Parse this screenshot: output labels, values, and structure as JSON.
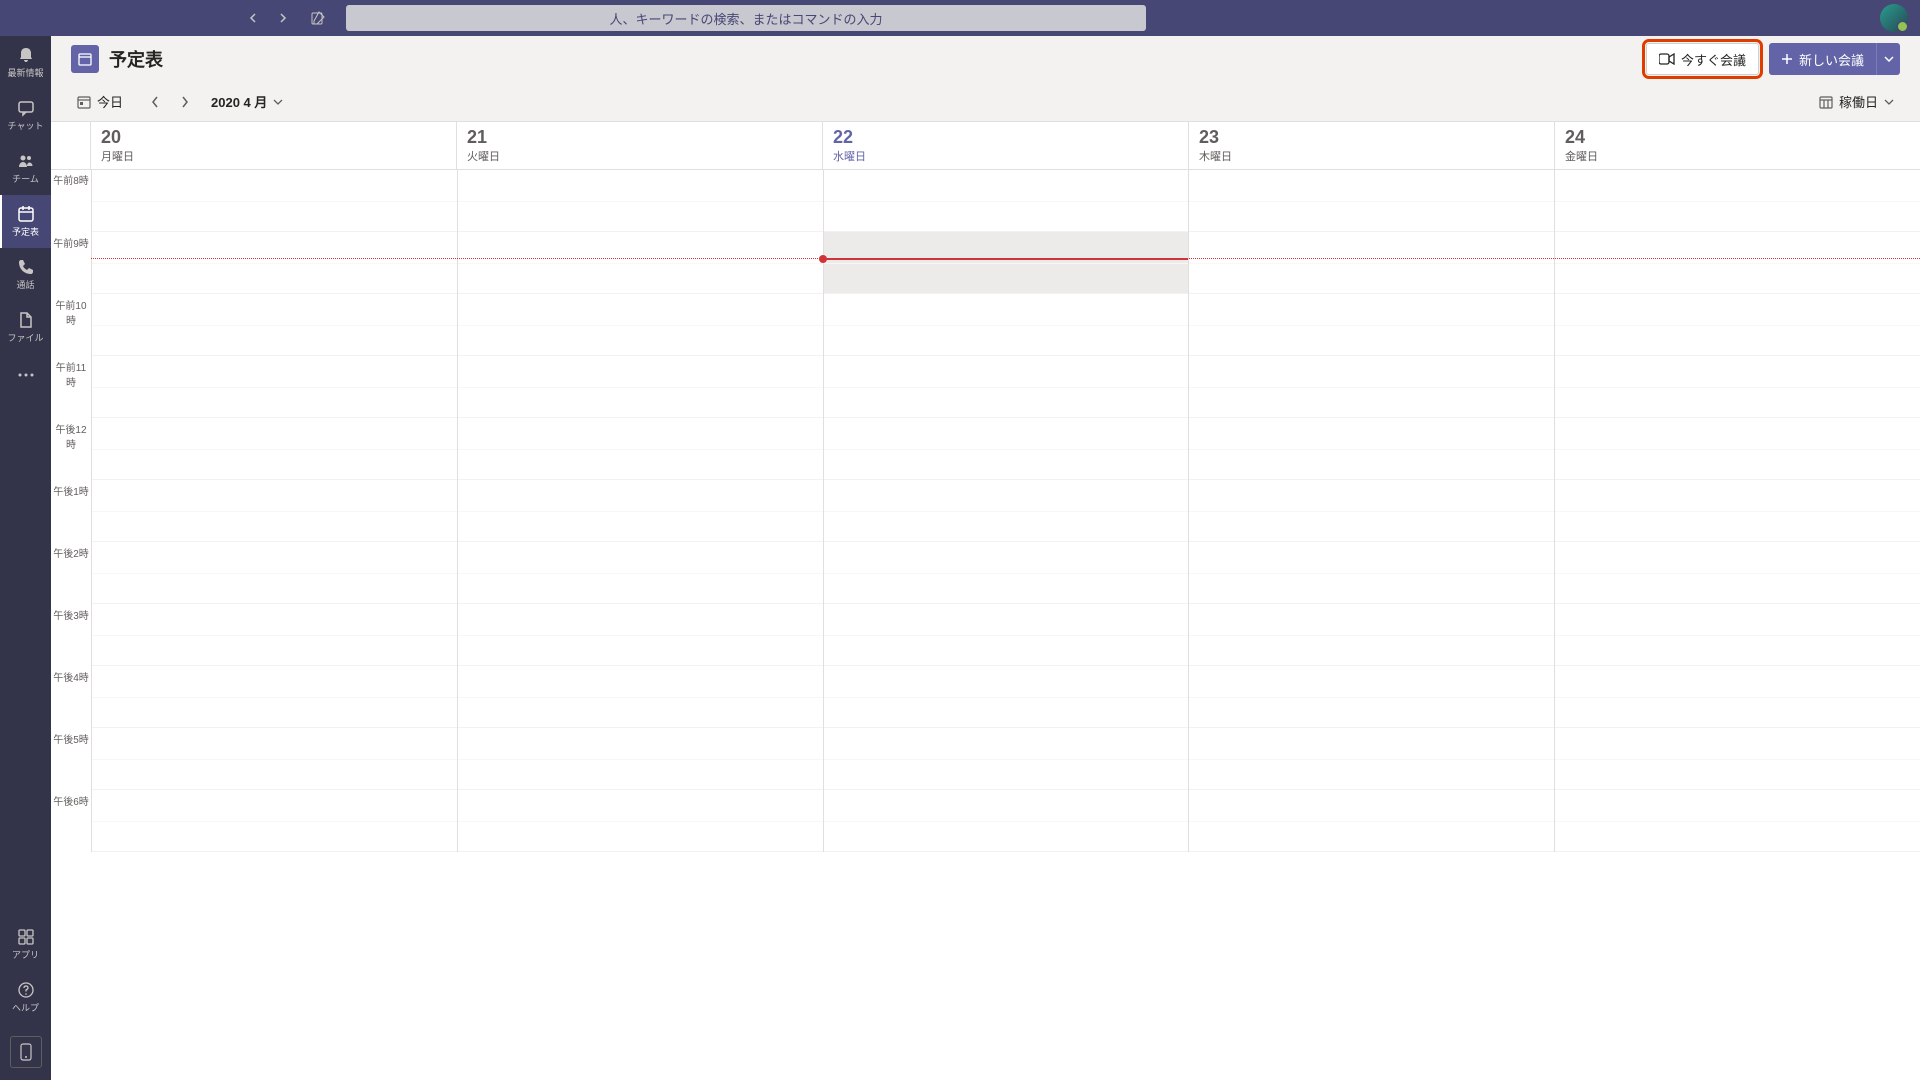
{
  "topbar": {
    "search_placeholder": "人、キーワードの検索、またはコマンドの入力"
  },
  "sidebar": {
    "items": [
      {
        "label": "最新情報"
      },
      {
        "label": "チャット"
      },
      {
        "label": "チーム"
      },
      {
        "label": "予定表"
      },
      {
        "label": "通話"
      },
      {
        "label": "ファイル"
      }
    ],
    "apps_label": "アプリ",
    "help_label": "ヘルプ"
  },
  "header": {
    "title": "予定表",
    "meet_now_label": "今すぐ会議",
    "new_meeting_label": "新しい会議"
  },
  "toolbar": {
    "today_label": "今日",
    "month_label": "2020 4 月",
    "view_label": "稼働日"
  },
  "calendar": {
    "days": [
      {
        "num": "20",
        "name": "月曜日",
        "today": false
      },
      {
        "num": "21",
        "name": "火曜日",
        "today": false
      },
      {
        "num": "22",
        "name": "水曜日",
        "today": true
      },
      {
        "num": "23",
        "name": "木曜日",
        "today": false
      },
      {
        "num": "24",
        "name": "金曜日",
        "today": false
      }
    ],
    "times": [
      "午前8時",
      "午前9時",
      "午前10時",
      "午前11時",
      "午後12時",
      "午後1時",
      "午後2時",
      "午後3時",
      "午後4時",
      "午後5時",
      "午後6時"
    ]
  }
}
